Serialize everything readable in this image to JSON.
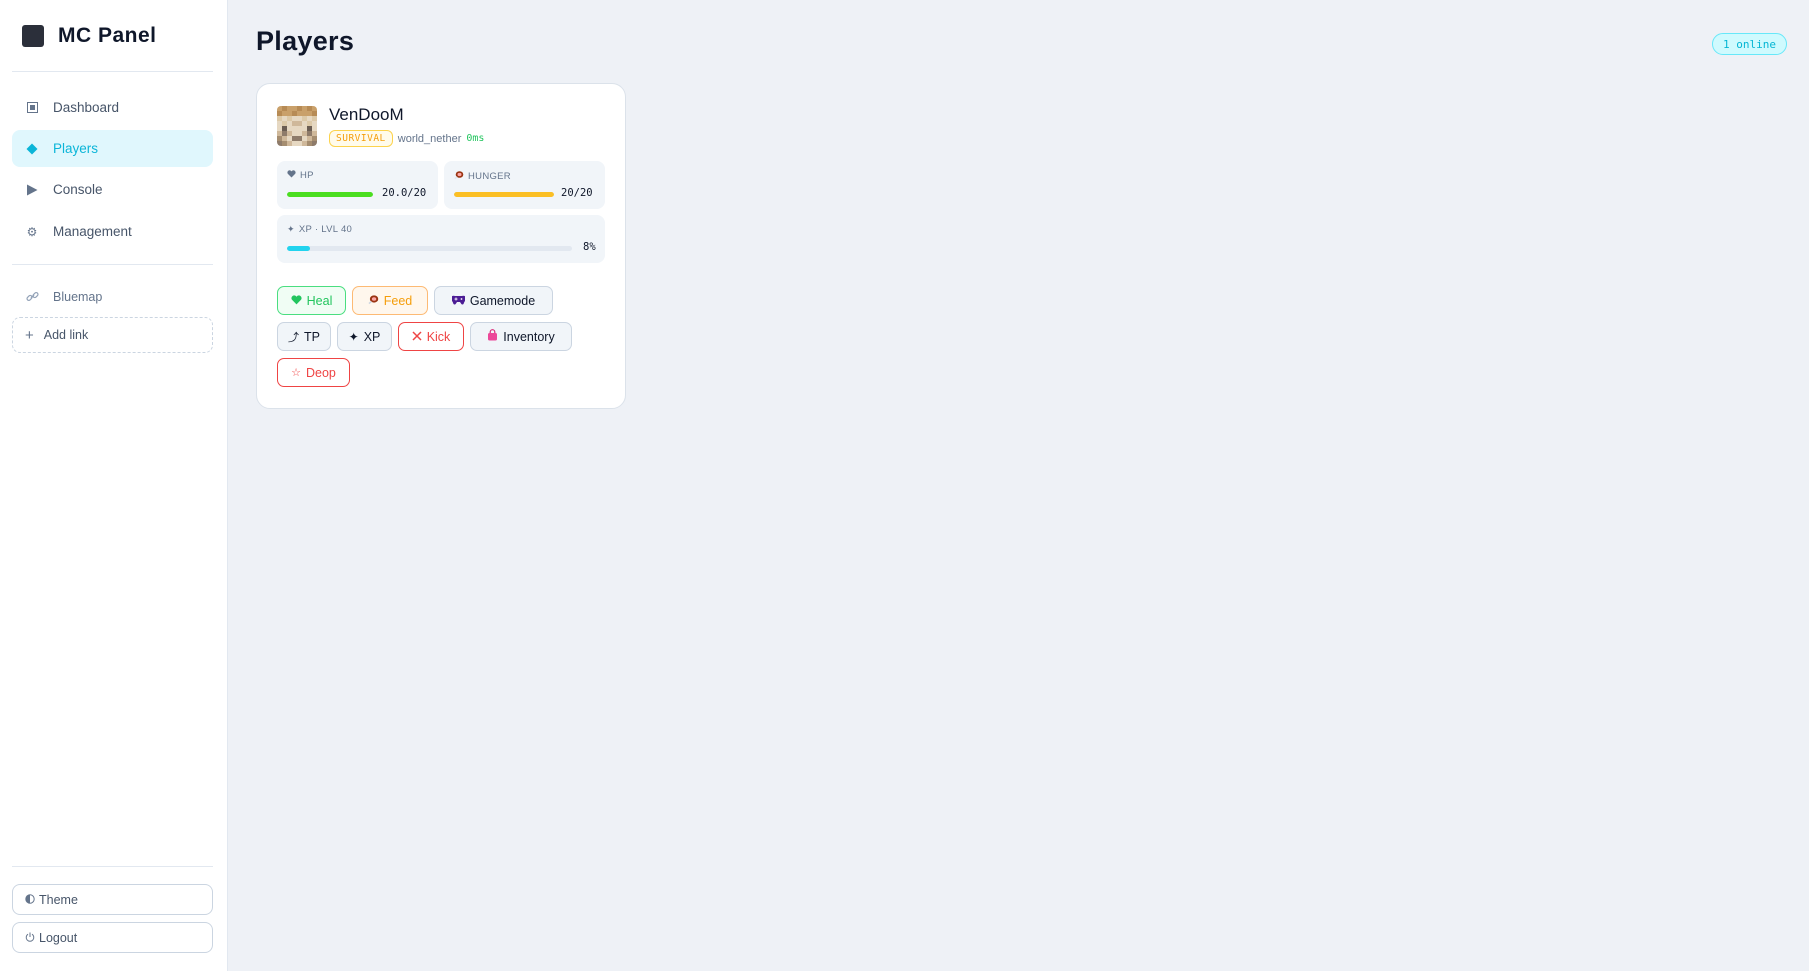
{
  "app": {
    "name": "MC Panel"
  },
  "sidebar": {
    "nav": [
      {
        "label": "Dashboard",
        "icon": "dashboard-icon"
      },
      {
        "label": "Players",
        "icon": "players-icon",
        "active": true
      },
      {
        "label": "Console",
        "icon": "console-icon"
      },
      {
        "label": "Management",
        "icon": "gear-icon"
      }
    ],
    "links": [
      {
        "label": "Bluemap",
        "icon": "link-icon"
      }
    ],
    "add_link_label": "Add link",
    "theme_label": "Theme",
    "logout_label": "Logout"
  },
  "page": {
    "title": "Players",
    "online_badge": "1 online"
  },
  "player": {
    "name": "VenDooM",
    "gamemode": "SURVIVAL",
    "world": "world_nether",
    "ping": "0ms",
    "hp": {
      "label": "HP",
      "value": "20.0/20",
      "fraction": 1.0
    },
    "hunger": {
      "label": "HUNGER",
      "value": "20/20",
      "fraction": 1.0
    },
    "xp": {
      "label": "XP · LVL 40",
      "value": "8%",
      "fraction": 0.08
    },
    "actions": [
      {
        "label": "Heal",
        "icon": "heart-icon",
        "style": "green"
      },
      {
        "label": "Feed",
        "icon": "meat-icon",
        "style": "orange"
      },
      {
        "label": "Gamemode",
        "icon": "gamepad-icon",
        "style": "neutral"
      },
      {
        "label": "TP",
        "icon": "teleport-icon",
        "style": "neutral"
      },
      {
        "label": "XP",
        "icon": "sparkle-icon",
        "style": "neutral"
      },
      {
        "label": "Kick",
        "icon": "close-icon",
        "style": "red"
      },
      {
        "label": "Inventory",
        "icon": "bag-icon",
        "style": "neutral"
      },
      {
        "label": "Deop",
        "icon": "star-icon",
        "style": "red"
      }
    ]
  },
  "colors": {
    "accent": "#0bb5d8",
    "hp_bar": "#4ade20",
    "hunger_bar": "#fbbf24",
    "xp_bar": "#22d3ee",
    "danger": "#ef4444"
  }
}
